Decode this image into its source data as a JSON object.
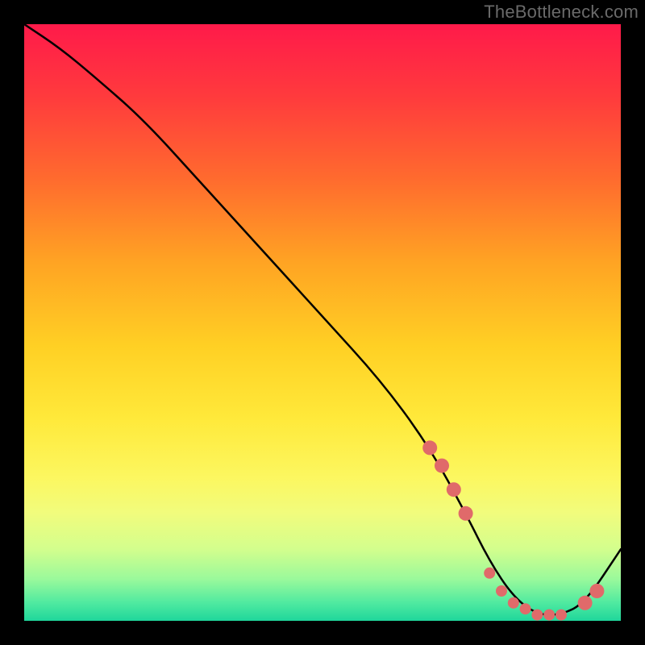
{
  "watermark": "TheBottleneck.com",
  "chart_data": {
    "type": "line",
    "title": "",
    "xlabel": "",
    "ylabel": "",
    "xlim": [
      0,
      100
    ],
    "ylim": [
      0,
      100
    ],
    "series": [
      {
        "name": "curve",
        "x": [
          0,
          6,
          12,
          20,
          30,
          40,
          50,
          60,
          68,
          74,
          78,
          82,
          86,
          90,
          94,
          100
        ],
        "y": [
          100,
          96,
          91,
          84,
          73,
          62,
          51,
          40,
          29,
          18,
          10,
          4,
          1,
          1,
          3,
          12
        ]
      }
    ],
    "markers": {
      "name": "highlight-dots",
      "color": "#e06a6a",
      "x": [
        68,
        70,
        72,
        74,
        78,
        80,
        82,
        84,
        86,
        88,
        90,
        94,
        96
      ],
      "y": [
        29,
        26,
        22,
        18,
        8,
        5,
        3,
        2,
        1,
        1,
        1,
        3,
        5
      ]
    },
    "gradient_stops": [
      {
        "pos": 0,
        "color": "#ff1a4a"
      },
      {
        "pos": 12,
        "color": "#ff3a3d"
      },
      {
        "pos": 26,
        "color": "#ff6b2e"
      },
      {
        "pos": 40,
        "color": "#ffa423"
      },
      {
        "pos": 54,
        "color": "#ffd024"
      },
      {
        "pos": 66,
        "color": "#ffe93a"
      },
      {
        "pos": 76,
        "color": "#fcf760"
      },
      {
        "pos": 82,
        "color": "#f1fc7d"
      },
      {
        "pos": 88,
        "color": "#d3fe8d"
      },
      {
        "pos": 93,
        "color": "#9af99b"
      },
      {
        "pos": 97,
        "color": "#4feaa0"
      },
      {
        "pos": 100,
        "color": "#1fd69b"
      }
    ]
  }
}
